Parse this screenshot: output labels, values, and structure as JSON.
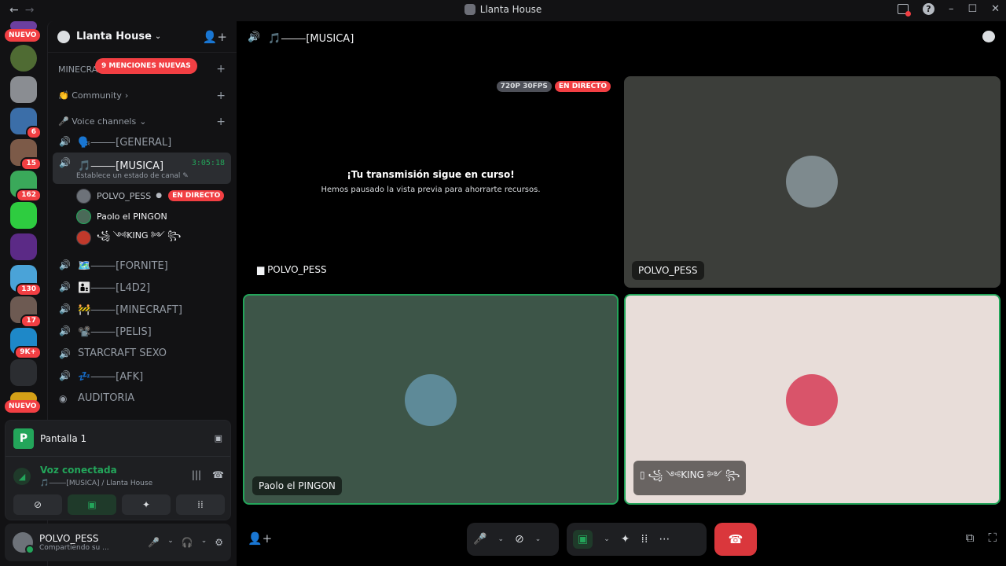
{
  "window": {
    "title": "Llanta House",
    "back_label": "←",
    "forward_label": "→",
    "help_label": "?",
    "min_label": "–",
    "max_label": "☐",
    "close_label": "✕"
  },
  "rail": {
    "top_pill": "NUEVO",
    "bottom_pill": "NUEVO",
    "badges": [
      "6",
      "15",
      "162",
      "130",
      "17",
      "9K+"
    ]
  },
  "sidebar": {
    "guild_name": "Llanta House",
    "mentions_pill": "9 MENCIONES NUEVAS",
    "categories": {
      "minecraft": "MINECRA",
      "community": "👏 Community",
      "voice": "🎤 Voice channels"
    },
    "channels": [
      {
        "name": "🗣️⸻[GENERAL]"
      },
      {
        "name": "🎵⸻[MUSICA]",
        "timer": "3:05:18",
        "status": "Establece un estado de canal"
      },
      {
        "name": "🗺️⸻[FORNITE]"
      },
      {
        "name": "👨‍👦⸻[L4D2]"
      },
      {
        "name": "🚧⸻[MINECRAFT]"
      },
      {
        "name": "📽️⸻[PELIS]"
      },
      {
        "name": "STARCRAFT SEXO"
      },
      {
        "name": "💤⸻[AFK]"
      },
      {
        "name": "AUDITORIA"
      }
    ],
    "voice_users": [
      {
        "name": "POLVO_PESS",
        "live": "EN DIRECTO",
        "av_color": "#6d7279"
      },
      {
        "name": "Paolo el PINGON",
        "av_color": "#4a6a58"
      },
      {
        "name": "꧁ ༺KING ༻ ꧂",
        "av_color": "#c0392b"
      }
    ]
  },
  "stream_panel": {
    "app_letter": "P",
    "title": "Pantalla 1",
    "voice_status": "Voz conectada",
    "voice_location": "🎵⸻[MUSICA] / Llanta House"
  },
  "user_panel": {
    "name": "POLVO_PESS",
    "status": "Compartiendo su ..."
  },
  "main": {
    "channel_title": "🎵⸻[MUSICA]",
    "tiles": [
      {
        "label": "POLVO_PESS",
        "quality": "720P 30FPS",
        "live": "EN DIRECTO",
        "paused_title": "¡Tu transmisión sigue en curso!",
        "paused_sub": "Hemos pausado la vista previa para ahorrarte recursos.",
        "bg": "#000000"
      },
      {
        "label": "POLVO_PESS",
        "bg": "#3c3e3a",
        "av_color": "#7e8a8e"
      },
      {
        "label": "Paolo el PINGON",
        "bg": "#3d5548",
        "av_color": "#5e8a98"
      },
      {
        "label": "꧁ ༺KING ༻ ꧂",
        "bg": "#e8ddd9",
        "av_color": "#d9546a"
      }
    ]
  },
  "icons": {
    "speaker": "🔊",
    "add_member": "👤+",
    "chat": "💬",
    "mic": "🎤",
    "headset": "🎧",
    "settings": "⚙",
    "hangup": "☎",
    "popout": "⧉",
    "fullscreen": "⛶",
    "soundboard": "⁞⁞",
    "activities": "✦",
    "more": "⋯"
  },
  "colors": {
    "accent_green": "#23a55a",
    "danger_red": "#f23f43",
    "bg_dark": "#121214"
  }
}
